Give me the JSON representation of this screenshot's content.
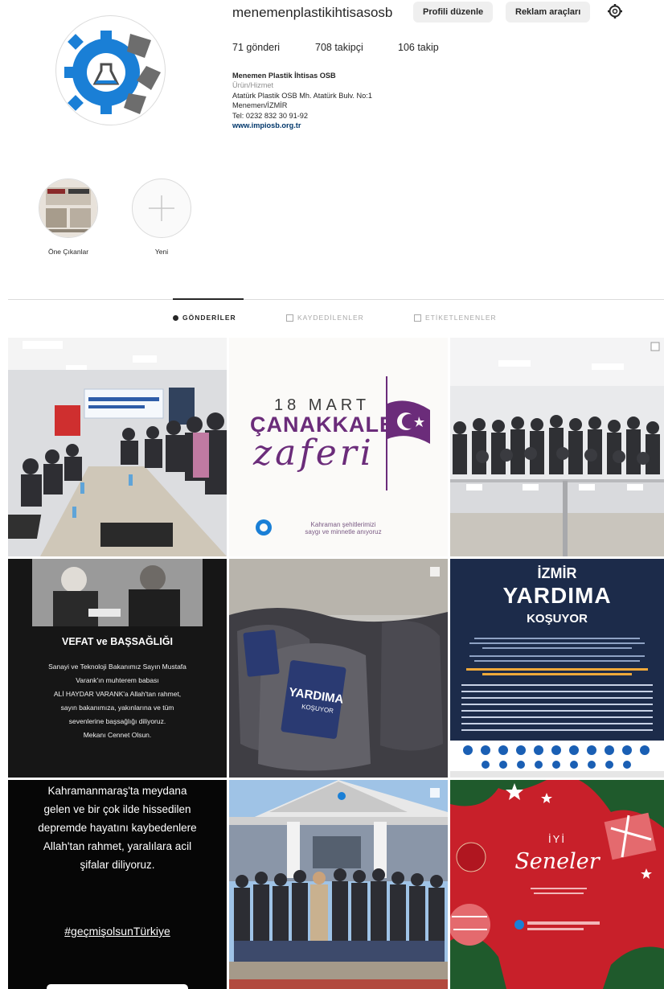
{
  "profile": {
    "username": "menemenplastikihtisasosb",
    "edit_button": "Profili düzenle",
    "ads_button": "Reklam araçları",
    "stats": {
      "posts": "71 gönderi",
      "followers": "708 takipçi",
      "following": "106 takip"
    },
    "bio": {
      "name": "Menemen Plastik İhtisas OSB",
      "category": "Ürün/Hizmet",
      "address1": "Atatürk Plastik OSB Mh. Atatürk Bulv. No:1",
      "address2": "Menemen/İZMİR",
      "phone": "Tel: 0232 832 30 91-92",
      "link": "www.impiosb.org.tr"
    }
  },
  "highlights": [
    {
      "label": "Öne Çıkanlar"
    },
    {
      "label": "Yeni"
    }
  ],
  "tabs": [
    {
      "label": "GÖNDERİLER",
      "active": true
    },
    {
      "label": "KAYDEDİLENLER",
      "active": false
    },
    {
      "label": "ETİKETLENENLER",
      "active": false
    }
  ],
  "posts": {
    "p2": {
      "line1": "18 MART",
      "line2": "ÇANAKKALE",
      "line3": "zaferi",
      "caption1": "Kahraman şehitlerimizi",
      "caption2": "saygı ve minnetle anıyoruz"
    },
    "p4": {
      "title": "VEFAT ve BAŞSAĞLIĞI",
      "l1": "Sanayi ve Teknoloji Bakanımız Sayın Mustafa",
      "l2": "Varank'ın muhterem babası",
      "l3": "ALİ HAYDAR VARANK'a Allah'tan rahmet,",
      "l4": "sayın bakanımıza, yakınlarına ve tüm",
      "l5": "sevenlerine başsağlığı diliyoruz.",
      "l6": "Mekanı Cennet Olsun."
    },
    "p5": {
      "bag_title": "YARDIMA",
      "bag_sub": "KOŞUYOR"
    },
    "p6": {
      "l1": "İZMİR",
      "l2": "YARDIMA",
      "l3": "KOŞUYOR"
    },
    "p7": {
      "l1": "Kahramanmaraş'ta meydana",
      "l2": "gelen ve bir çok ilde hissedilen",
      "l3": "depremde hayatını kaybedenlere",
      "l4": "Allah'tan rahmet, yaralılara acil",
      "l5": "şifalar diliyoruz.",
      "hashtag": "#geçmişolsunTürkiye"
    },
    "p9": {
      "l1": "İYİ",
      "l2": "Seneler"
    }
  },
  "colors": {
    "accent_purple": "#6b2c7a",
    "link_blue": "#00376b",
    "red_bg": "#c8202a",
    "navy_bg": "#1c2b4a"
  }
}
